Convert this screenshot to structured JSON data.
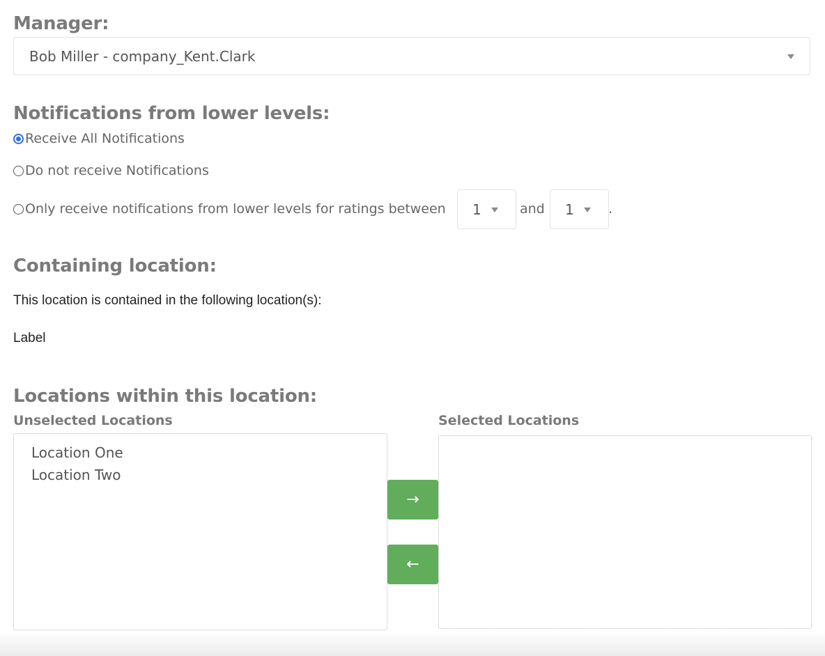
{
  "manager": {
    "heading": "Manager:",
    "selected": "Bob Miller - company_Kent.Clark",
    "caret_icon": "caret-down-icon"
  },
  "notifications": {
    "heading": "Notifications from lower levels:",
    "options": [
      {
        "label": "Receive All Notifications",
        "checked": true
      },
      {
        "label": "Do not receive Notifications",
        "checked": false
      },
      {
        "label": "Only receive notifications from lower levels for ratings between",
        "checked": false
      }
    ],
    "rating_from": "1",
    "and_text": "and",
    "rating_to": "1",
    "period": "."
  },
  "containing": {
    "heading": "Containing location:",
    "description": "This location is contained in the following location(s):",
    "label": "Label"
  },
  "within": {
    "heading": "Locations within this location:",
    "unselected_label": "Unselected Locations",
    "selected_label": "Selected Locations",
    "unselected_items": [
      "Location One",
      "Location Two"
    ],
    "selected_items": [],
    "move_right_icon": "→",
    "move_left_icon": "←"
  },
  "colors": {
    "accent_button": "#62ad5b",
    "radio_checked": "#2f6fe0",
    "heading": "#7a7a7a"
  }
}
